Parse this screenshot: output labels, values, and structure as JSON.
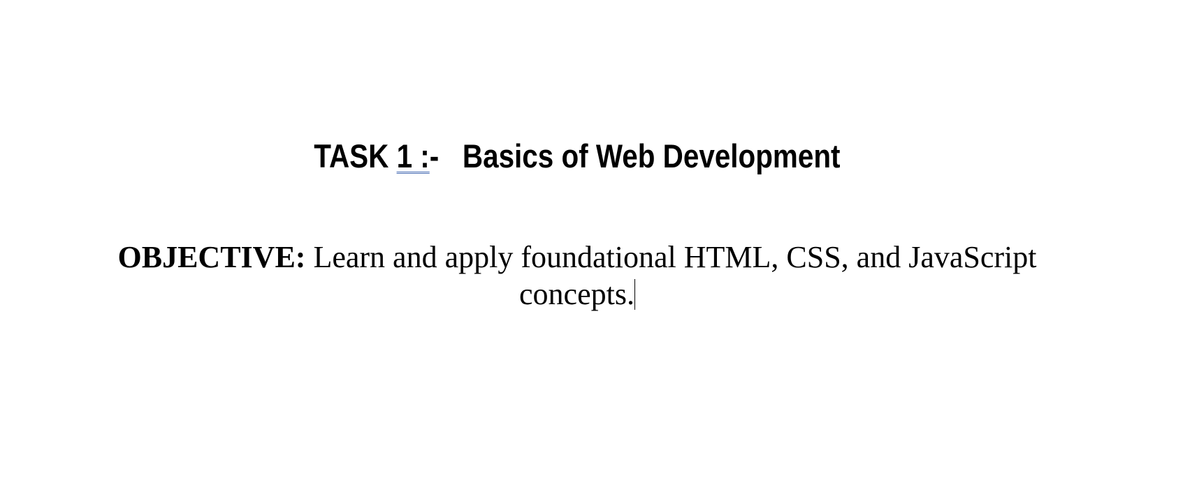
{
  "document": {
    "title": {
      "prefix": "TASK ",
      "number": "1 :",
      "separator": "-   ",
      "text": "Basics of Web Development"
    },
    "objective": {
      "label": "OBJECTIVE:",
      "text": " Learn and apply foundational HTML, CSS, and JavaScript concepts."
    }
  }
}
